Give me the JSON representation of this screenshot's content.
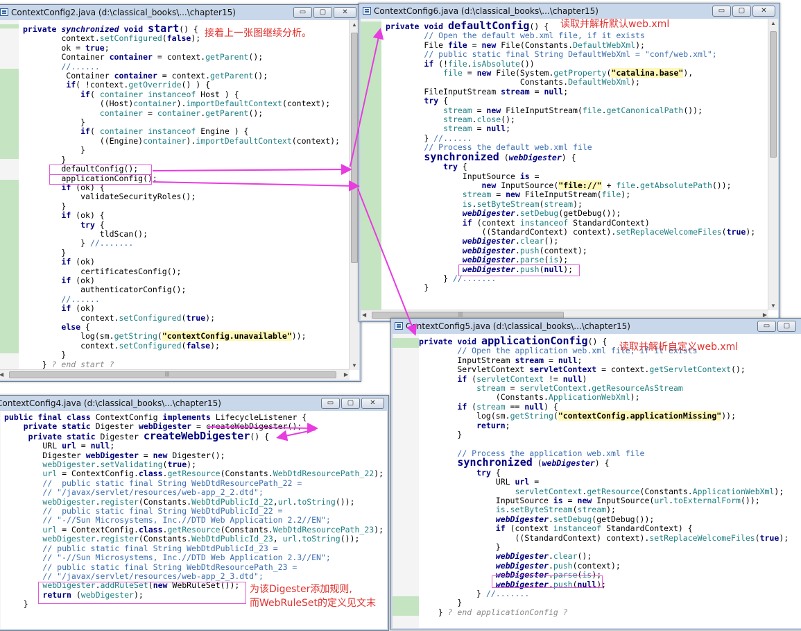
{
  "windows": {
    "config2": {
      "title": "ContextConfig2.java (d:\\classical_books\\...\\chapter15)",
      "lines": [
        "<span class=\"k\">private</span> <span class=\"k\"><i>synchronized</i></span> <span class=\"k\">void</span> <span class=\"big\">start</span>() {",
        "        context.<span class=\"f\">setConfigured</span>(<span class=\"k\">false</span>);",
        "        ok = <span class=\"k\">true</span>;",
        "        Container <span class=\"k\">container</span> = context.<span class=\"f\">getParent</span>();",
        "        <span class=\"c\">//......</span>",
        "         Container <span class=\"k\">container</span> = context.<span class=\"f\">getParent</span>();",
        "         <span class=\"k\">if</span>( !context.<span class=\"f\">getOverride</span>() ) {",
        "            <span class=\"k\">if</span>( <span class=\"f\">container</span> <span class=\"f\">instanceof</span> Host ) {",
        "                ((Host)<span class=\"f\">container</span>).<span class=\"f\">importDefaultContext</span>(context);",
        "                <span class=\"f\">container</span> = <span class=\"f\">container</span>.<span class=\"f\">getParent</span>();",
        "            }",
        "            <span class=\"k\">if</span>( <span class=\"f\">container</span> <span class=\"f\">instanceof</span> Engine ) {",
        "                ((Engine)<span class=\"f\">container</span>).<span class=\"f\">importDefaultContext</span>(context);",
        "            }",
        "        }",
        "        defaultConfig();",
        "        applicationConfig();",
        "        <span class=\"k\">if</span> (ok) {",
        "            validateSecurityRoles();",
        "        }",
        "        <span class=\"k\">if</span> (ok) {",
        "            <span class=\"k\">try</span> {",
        "                tldScan();",
        "            } <span class=\"c\">//.......</span>",
        "        }",
        "        <span class=\"k\">if</span> (ok)",
        "            certificatesConfig();",
        "        <span class=\"k\">if</span> (ok)",
        "            authenticatorConfig();",
        "        <span class=\"c\">//......</span>",
        "        <span class=\"k\">if</span> (ok)",
        "            context.<span class=\"f\">setConfigured</span>(<span class=\"k\">true</span>);",
        "        <span class=\"k\">else</span> {",
        "            log(sm.<span class=\"f\">getString</span>(<span class=\"s\">\"contextConfig.unavailable\"</span>));",
        "            context.<span class=\"f\">setConfigured</span>(<span class=\"k\">false</span>);",
        "        }",
        "    } <span class=\"fold\">? end start ?</span>"
      ]
    },
    "config6": {
      "title": "ContextConfig6.java (d:\\classical_books\\...\\chapter15)",
      "lines": [
        "<span class=\"k\">private</span> <span class=\"k\">void</span> <span class=\"big\">defaultConfig</span>() {",
        "        <span class=\"c\">// Open the default web.xml file, if it exists</span>",
        "        File <span class=\"k\">file</span> = <span class=\"k\">new</span> File(Constants.<span class=\"f\">DefaultWebXml</span>);",
        "        <span class=\"c\">// public static final String DefaultWebXml = \"conf/web.xml\";</span>",
        "        <span class=\"k\">if</span> (!<span class=\"f\">file</span>.<span class=\"f\">isAbsolute</span>())",
        "            <span class=\"f\">file</span> = <span class=\"k\">new</span> File(System.<span class=\"f\">getProperty</span>(<span class=\"s\">\"catalina.base\"</span>),",
        "                            Constants.<span class=\"f\">DefaultWebXml</span>);",
        "        FileInputStream <span class=\"k\">stream</span> = <span class=\"k\">null</span>;",
        "        <span class=\"k\">try</span> {",
        "            <span class=\"f\">stream</span> = <span class=\"k\">new</span> FileInputStream(<span class=\"f\">file</span>.<span class=\"f\">getCanonicalPath</span>());",
        "            <span class=\"f\">stream</span>.<span class=\"f\">close</span>();",
        "            <span class=\"f\">stream</span> = <span class=\"k\">null</span>;",
        "        } <span class=\"c\">//......</span>",
        "        <span class=\"c\">// Process the default web.xml file</span>",
        "        <span class=\"bigs\">synchronized</span> (<span class=\"v\">webDigester</span>) {",
        "            <span class=\"k\">try</span> {",
        "                InputSource <span class=\"k\">is</span> =",
        "                    <span class=\"k\">new</span> InputSource(<span class=\"s\">\"file://\"</span> + <span class=\"f\">file</span>.<span class=\"f\">getAbsolutePath</span>());",
        "                <span class=\"f\">stream</span> = <span class=\"k\">new</span> FileInputStream(<span class=\"f\">file</span>);",
        "                <span class=\"f\">is</span>.<span class=\"f\">setByteStream</span>(<span class=\"f\">stream</span>);",
        "                <span class=\"v\">webDigester</span>.<span class=\"f\">setDebug</span>(getDebug());",
        "                <span class=\"k\">if</span> (context <span class=\"f\">instanceof</span> StandardContext)",
        "                    ((StandardContext) context).<span class=\"f\">setReplaceWelcomeFiles</span>(<span class=\"k\">true</span>);",
        "                <span class=\"v\">webDigester</span>.<span class=\"f\">clear</span>();",
        "                <span class=\"v\">webDigester</span>.<span class=\"f\">push</span>(context);",
        "                <span class=\"v\">webDigester</span>.<span class=\"f\">parse</span>(<span class=\"f\">is</span>);",
        "                <span class=\"v\">webDigester</span>.<span class=\"f\">push</span>(<span class=\"k\">null</span>);",
        "            } <span class=\"c\">//.......</span>",
        "        }"
      ]
    },
    "config5": {
      "title": "ContextConfig5.java (d:\\classical_books\\...\\chapter15)",
      "lines": [
        "<span class=\"k\">private</span> <span class=\"k\">void</span> <span class=\"big\">applicationConfig</span>() {",
        "        <span class=\"c\">// Open the application web.xml file, if it exists</span>",
        "        InputStream <span class=\"k\">stream</span> = <span class=\"k\">null</span>;",
        "        ServletContext <span class=\"k\">servletContext</span> = context.<span class=\"f\">getServletContext</span>();",
        "        <span class=\"k\">if</span> (<span class=\"f\">servletContext</span> != <span class=\"k\">null</span>)",
        "            <span class=\"f\">stream</span> = <span class=\"f\">servletContext</span>.<span class=\"f\">getResourceAsStream</span>",
        "                (Constants.<span class=\"f\">ApplicationWebXml</span>);",
        "        <span class=\"k\">if</span> (<span class=\"f\">stream</span> == <span class=\"k\">null</span>) {",
        "            log(sm.<span class=\"f\">getString</span>(<span class=\"s\">\"contextConfig.applicationMissing\"</span>));",
        "            <span class=\"k\">return</span>;",
        "        }",
        "",
        "        <span class=\"c\">// Process the application web.xml file</span>",
        "        <span class=\"bigs\">synchronized</span> (<span class=\"v\">webDigester</span>) {",
        "            <span class=\"k\">try</span> {",
        "                URL <span class=\"k\">url</span> =",
        "                    <span class=\"f\">servletContext</span>.<span class=\"f\">getResource</span>(Constants.<span class=\"f\">ApplicationWebXml</span>);",
        "                InputSource <span class=\"k\">is</span> = <span class=\"k\">new</span> InputSource(<span class=\"f\">url</span>.<span class=\"f\">toExternalForm</span>());",
        "                <span class=\"f\">is</span>.<span class=\"f\">setByteStream</span>(<span class=\"f\">stream</span>);",
        "                <span class=\"v\">webDigester</span>.<span class=\"f\">setDebug</span>(getDebug());",
        "                <span class=\"k\">if</span> (context <span class=\"f\">instanceof</span> StandardContext) {",
        "                    ((StandardContext) context).<span class=\"f\">setReplaceWelcomeFiles</span>(<span class=\"k\">true</span>);",
        "                }",
        "                <span class=\"v\">webDigester</span>.<span class=\"f\">clear</span>();",
        "                <span class=\"v\">webDigester</span>.<span class=\"f\">push</span>(context);",
        "                <span class=\"v\">webDigester</span>.<span class=\"f\">parse</span>(<span class=\"f\">is</span>);",
        "                <span class=\"v\">webDigester</span>.<span class=\"f\">push</span>(<span class=\"k\">null</span>);",
        "            } <span class=\"c\">//.......</span>",
        "        }",
        "    } <span class=\"fold\">? end applicationConfig ?</span>"
      ]
    },
    "config4": {
      "title": "ContextConfig4.java (d:\\classical_books\\...\\chapter15)",
      "lines": [
        "<span class=\"k\">public</span> <span class=\"k\">final</span> <span class=\"k\">class</span> ContextConfig <span class=\"k\">implements</span> LifecycleListener {",
        "    <span class=\"k\">private</span> <span class=\"k\">static</span> Digester <span class=\"k\">webDigester</span> = createWebDigester();",
        "     <span class=\"k\">private</span> <span class=\"k\">static</span> Digester <span class=\"big\">createWebDigester</span>() {",
        "        URL <span class=\"k\">url</span> = <span class=\"k\">null</span>;",
        "        Digester <span class=\"k\">webDigester</span> = <span class=\"k\">new</span> Digester();",
        "        <span class=\"f\">webDigester</span>.<span class=\"f\">setValidating</span>(<span class=\"k\">true</span>);",
        "        <span class=\"f\">url</span> = ContextConfig.<span class=\"k\">class</span>.<span class=\"f\">getResource</span>(Constants.<span class=\"f\">WebDtdResourcePath_22</span>);",
        "        <span class=\"c\">//  public static final String WebDtdResourcePath_22 =</span>",
        "        <span class=\"c\">// \"/javax/servlet/resources/web-app_2_2.dtd\";</span>",
        "        <span class=\"f\">webDigester</span>.<span class=\"f\">register</span>(Constants.<span class=\"f\">WebDtdPublicId_22</span>,<span class=\"f\">url</span>.<span class=\"f\">toString</span>());",
        "        <span class=\"c\">//  public static final String WebDtdPublicId_22 =</span>",
        "        <span class=\"c\">// \"-//Sun Microsystems, Inc.//DTD Web Application 2.2//EN\";</span>",
        "        <span class=\"f\">url</span> = ContextConfig.<span class=\"k\">class</span>.<span class=\"f\">getResource</span>(Constants.<span class=\"f\">WebDtdResourcePath_23</span>);",
        "        <span class=\"f\">webDigester</span>.<span class=\"f\">register</span>(Constants.<span class=\"f\">WebDtdPublicId_23</span>, <span class=\"f\">url</span>.<span class=\"f\">toString</span>());",
        "        <span class=\"c\">// public static final String WebDtdPublicId_23 =</span>",
        "        <span class=\"c\">// \"-//Sun Microsystems, Inc.//DTD Web Application 2.3//EN\";</span>",
        "        <span class=\"c\">// public static final String WebDtdResourcePath_23 =</span>",
        "        <span class=\"c\">// \"/javax/servlet/resources/web-app_2_3.dtd\";</span>",
        "        <span class=\"f\">webDigester</span>.<span class=\"f\">addRuleSet</span>(<span class=\"k\">new</span> WebRuleSet());",
        "        <span class=\"k\">return</span> (<span class=\"f\">webDigester</span>);",
        "    }"
      ]
    }
  },
  "annotations": {
    "start_note": "接着上一张图继续分析。",
    "default_note": "读取并解析默认web.xml",
    "app_note": "读取并解析自定义web.xml",
    "rule_note_1": "为该Digester添加规则,",
    "rule_note_2": "而WebRuleSet的定义见文末"
  },
  "window_buttons": {
    "minimize": "▭",
    "maximize": "▢",
    "close": "✕"
  },
  "scroll_arrows": {
    "up": "▲",
    "down": "▼",
    "left": "◀",
    "right": "▶",
    "grip": "|||"
  },
  "colors": {
    "keyword": "#000080",
    "field": "#1e7f84",
    "comment": "#3d6fb0",
    "annotation": "#e0312e",
    "arrow": "#e83be0",
    "gutter_mark": "#c5e4c1"
  }
}
